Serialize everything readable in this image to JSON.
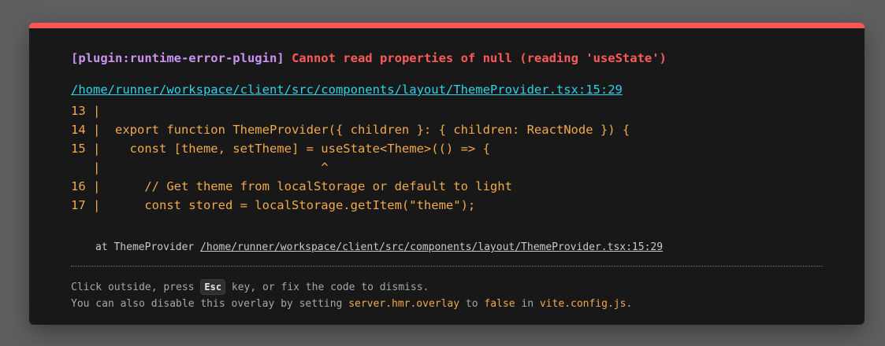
{
  "error": {
    "plugin": "[plugin:runtime-error-plugin]",
    "message": "Cannot read properties of null (reading 'useState')",
    "file": "/home/runner/workspace/client/src/components/layout/ThemeProvider.tsx:15:29"
  },
  "frame": {
    "lines": [
      "13 |",
      "14 |  export function ThemeProvider({ children }: { children: ReactNode }) {",
      "15 |    const [theme, setTheme] = useState<Theme>(() => {",
      "   |                              ^",
      "16 |      // Get theme from localStorage or default to light",
      "17 |      const stored = localStorage.getItem(\"theme\");"
    ]
  },
  "stack": {
    "prefix": "at ThemeProvider ",
    "file": "/home/runner/workspace/client/src/components/layout/ThemeProvider.tsx:15:29"
  },
  "tip": {
    "line1_before": "Click outside, press ",
    "key": "Esc",
    "line1_after": " key, or fix the code to dismiss.",
    "line2_before": "You can also disable this overlay by setting ",
    "setting": "server.hmr.overlay",
    "line2_mid": " to ",
    "value": "false",
    "line2_in": " in ",
    "config_file": "vite.config.js",
    "line2_end": "."
  },
  "colors": {
    "accent_red": "#ff5555",
    "plugin_purple": "#cb93f0",
    "file_cyan": "#2ad3ea",
    "code_orange": "#f2a94b"
  }
}
